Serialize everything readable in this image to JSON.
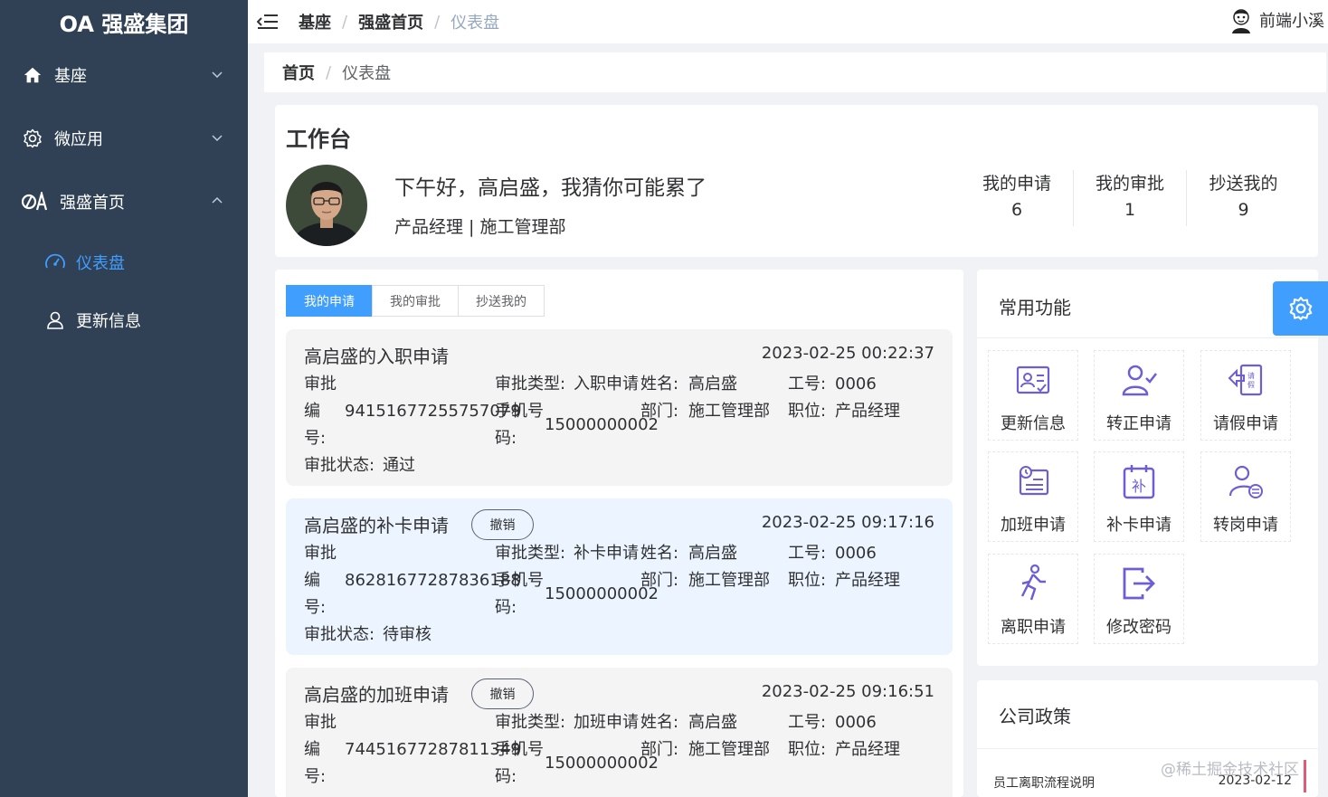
{
  "sidebar": {
    "logo": "OA 强盛集团",
    "items": [
      {
        "label": "基座",
        "icon": "home-icon"
      },
      {
        "label": "微应用",
        "icon": "gear-icon"
      },
      {
        "label": "强盛首页",
        "icon": "oa-logo-icon"
      }
    ],
    "subitems": [
      {
        "label": "仪表盘",
        "icon": "dashboard-icon",
        "active": true
      },
      {
        "label": "更新信息",
        "icon": "user-icon"
      }
    ]
  },
  "navbar": {
    "breadcrumb": [
      "基座",
      "强盛首页",
      "仪表盘"
    ],
    "username": "前端小溪"
  },
  "crumbbar": {
    "home": "首页",
    "current": "仪表盘"
  },
  "workbench": {
    "title": "工作台",
    "greeting": "下午好，高启盛，我猜你可能累了",
    "role": "产品经理 | 施工管理部",
    "stats": [
      {
        "label": "我的申请",
        "value": "6"
      },
      {
        "label": "我的审批",
        "value": "1"
      },
      {
        "label": "抄送我的",
        "value": "9"
      }
    ]
  },
  "tabs": [
    "我的申请",
    "我的审批",
    "抄送我的"
  ],
  "labels": {
    "approval_no_1": "审批",
    "approval_no_2": "编",
    "approval_no_3": "号:",
    "approval_type": "审批类型:",
    "name": "姓名:",
    "job_no": "工号:",
    "phone_1": "手机号",
    "phone_2": "码:",
    "dept": "部门:",
    "position": "职位:",
    "status": "审批状态:",
    "revoke": "撤销"
  },
  "applications": [
    {
      "title": "高启盛的入职申请",
      "time": "2023-02-25 00:22:37",
      "number": "94151677255757079",
      "type": "入职申请",
      "name": "高启盛",
      "job_no": "0006",
      "phone": "15000000002",
      "dept": "施工管理部",
      "position": "产品经理",
      "status": "通过",
      "revocable": false
    },
    {
      "title": "高启盛的补卡申请",
      "time": "2023-02-25 09:17:16",
      "number": "86281677287836188",
      "type": "补卡申请",
      "name": "高启盛",
      "job_no": "0006",
      "phone": "15000000002",
      "dept": "施工管理部",
      "position": "产品经理",
      "status": "待审核",
      "revocable": true
    },
    {
      "title": "高启盛的加班申请",
      "time": "2023-02-25 09:16:51",
      "number": "74451677287811349",
      "type": "加班申请",
      "name": "高启盛",
      "job_no": "0006",
      "phone": "15000000002",
      "dept": "施工管理部",
      "position": "产品经理",
      "status": "",
      "revocable": true
    }
  ],
  "functions": {
    "title": "常用功能",
    "items": [
      {
        "label": "更新信息",
        "icon": "id-card-icon"
      },
      {
        "label": "转正申请",
        "icon": "user-check-icon"
      },
      {
        "label": "请假申请",
        "icon": "leave-icon"
      },
      {
        "label": "加班申请",
        "icon": "overtime-icon"
      },
      {
        "label": "补卡申请",
        "icon": "calendar-fix-icon"
      },
      {
        "label": "转岗申请",
        "icon": "transfer-user-icon"
      },
      {
        "label": "离职申请",
        "icon": "walk-out-icon"
      },
      {
        "label": "修改密码",
        "icon": "exit-icon"
      }
    ]
  },
  "policy": {
    "title": "公司政策",
    "items": [
      {
        "label": "员工离职流程说明",
        "date": "2023-02-12"
      }
    ]
  },
  "watermark": "@稀土掘金技术社区",
  "colors": {
    "sidebar": "#304156",
    "primary": "#409eff",
    "icon_purple": "#6c5fd6"
  }
}
